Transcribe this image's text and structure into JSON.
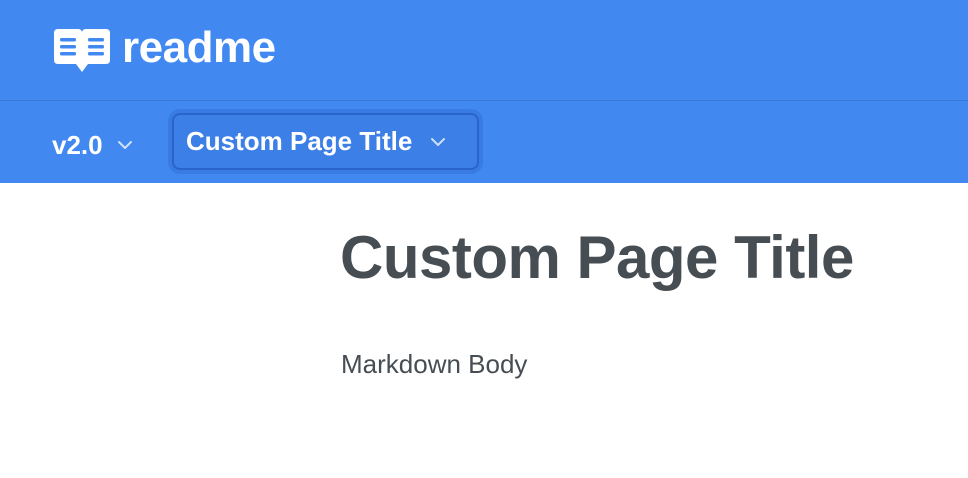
{
  "header": {
    "brand_text": "readme",
    "logo_icon": "book-icon",
    "background_color": "#4189f1"
  },
  "nav": {
    "version_label": "v2.0",
    "page_label": "Custom Page Title",
    "dropdown_icon": "chevron-down-icon"
  },
  "main": {
    "title": "Custom Page Title",
    "body": "Markdown Body",
    "text_color": "#464d53"
  }
}
